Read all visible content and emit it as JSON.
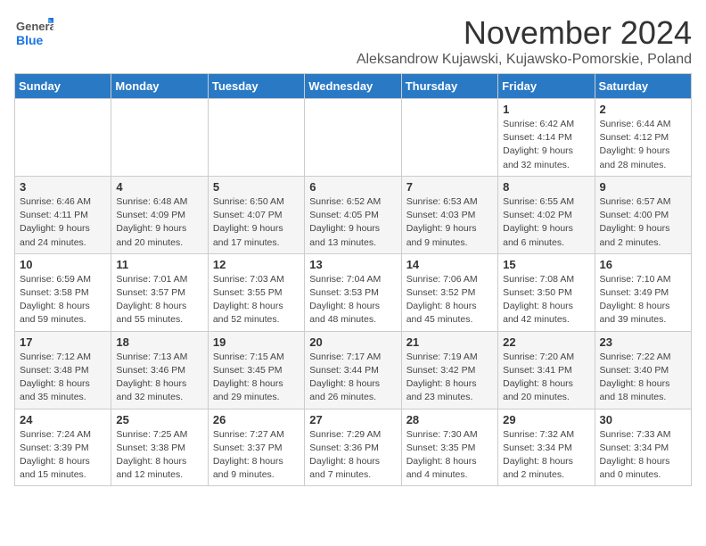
{
  "header": {
    "logo_line1": "General",
    "logo_line2": "Blue",
    "month": "November 2024",
    "location": "Aleksandrow Kujawski, Kujawsko-Pomorskie, Poland"
  },
  "weekdays": [
    "Sunday",
    "Monday",
    "Tuesday",
    "Wednesday",
    "Thursday",
    "Friday",
    "Saturday"
  ],
  "weeks": [
    [
      {
        "day": "",
        "info": ""
      },
      {
        "day": "",
        "info": ""
      },
      {
        "day": "",
        "info": ""
      },
      {
        "day": "",
        "info": ""
      },
      {
        "day": "",
        "info": ""
      },
      {
        "day": "1",
        "info": "Sunrise: 6:42 AM\nSunset: 4:14 PM\nDaylight: 9 hours and 32 minutes."
      },
      {
        "day": "2",
        "info": "Sunrise: 6:44 AM\nSunset: 4:12 PM\nDaylight: 9 hours and 28 minutes."
      }
    ],
    [
      {
        "day": "3",
        "info": "Sunrise: 6:46 AM\nSunset: 4:11 PM\nDaylight: 9 hours and 24 minutes."
      },
      {
        "day": "4",
        "info": "Sunrise: 6:48 AM\nSunset: 4:09 PM\nDaylight: 9 hours and 20 minutes."
      },
      {
        "day": "5",
        "info": "Sunrise: 6:50 AM\nSunset: 4:07 PM\nDaylight: 9 hours and 17 minutes."
      },
      {
        "day": "6",
        "info": "Sunrise: 6:52 AM\nSunset: 4:05 PM\nDaylight: 9 hours and 13 minutes."
      },
      {
        "day": "7",
        "info": "Sunrise: 6:53 AM\nSunset: 4:03 PM\nDaylight: 9 hours and 9 minutes."
      },
      {
        "day": "8",
        "info": "Sunrise: 6:55 AM\nSunset: 4:02 PM\nDaylight: 9 hours and 6 minutes."
      },
      {
        "day": "9",
        "info": "Sunrise: 6:57 AM\nSunset: 4:00 PM\nDaylight: 9 hours and 2 minutes."
      }
    ],
    [
      {
        "day": "10",
        "info": "Sunrise: 6:59 AM\nSunset: 3:58 PM\nDaylight: 8 hours and 59 minutes."
      },
      {
        "day": "11",
        "info": "Sunrise: 7:01 AM\nSunset: 3:57 PM\nDaylight: 8 hours and 55 minutes."
      },
      {
        "day": "12",
        "info": "Sunrise: 7:03 AM\nSunset: 3:55 PM\nDaylight: 8 hours and 52 minutes."
      },
      {
        "day": "13",
        "info": "Sunrise: 7:04 AM\nSunset: 3:53 PM\nDaylight: 8 hours and 48 minutes."
      },
      {
        "day": "14",
        "info": "Sunrise: 7:06 AM\nSunset: 3:52 PM\nDaylight: 8 hours and 45 minutes."
      },
      {
        "day": "15",
        "info": "Sunrise: 7:08 AM\nSunset: 3:50 PM\nDaylight: 8 hours and 42 minutes."
      },
      {
        "day": "16",
        "info": "Sunrise: 7:10 AM\nSunset: 3:49 PM\nDaylight: 8 hours and 39 minutes."
      }
    ],
    [
      {
        "day": "17",
        "info": "Sunrise: 7:12 AM\nSunset: 3:48 PM\nDaylight: 8 hours and 35 minutes."
      },
      {
        "day": "18",
        "info": "Sunrise: 7:13 AM\nSunset: 3:46 PM\nDaylight: 8 hours and 32 minutes."
      },
      {
        "day": "19",
        "info": "Sunrise: 7:15 AM\nSunset: 3:45 PM\nDaylight: 8 hours and 29 minutes."
      },
      {
        "day": "20",
        "info": "Sunrise: 7:17 AM\nSunset: 3:44 PM\nDaylight: 8 hours and 26 minutes."
      },
      {
        "day": "21",
        "info": "Sunrise: 7:19 AM\nSunset: 3:42 PM\nDaylight: 8 hours and 23 minutes."
      },
      {
        "day": "22",
        "info": "Sunrise: 7:20 AM\nSunset: 3:41 PM\nDaylight: 8 hours and 20 minutes."
      },
      {
        "day": "23",
        "info": "Sunrise: 7:22 AM\nSunset: 3:40 PM\nDaylight: 8 hours and 18 minutes."
      }
    ],
    [
      {
        "day": "24",
        "info": "Sunrise: 7:24 AM\nSunset: 3:39 PM\nDaylight: 8 hours and 15 minutes."
      },
      {
        "day": "25",
        "info": "Sunrise: 7:25 AM\nSunset: 3:38 PM\nDaylight: 8 hours and 12 minutes."
      },
      {
        "day": "26",
        "info": "Sunrise: 7:27 AM\nSunset: 3:37 PM\nDaylight: 8 hours and 9 minutes."
      },
      {
        "day": "27",
        "info": "Sunrise: 7:29 AM\nSunset: 3:36 PM\nDaylight: 8 hours and 7 minutes."
      },
      {
        "day": "28",
        "info": "Sunrise: 7:30 AM\nSunset: 3:35 PM\nDaylight: 8 hours and 4 minutes."
      },
      {
        "day": "29",
        "info": "Sunrise: 7:32 AM\nSunset: 3:34 PM\nDaylight: 8 hours and 2 minutes."
      },
      {
        "day": "30",
        "info": "Sunrise: 7:33 AM\nSunset: 3:34 PM\nDaylight: 8 hours and 0 minutes."
      }
    ]
  ]
}
